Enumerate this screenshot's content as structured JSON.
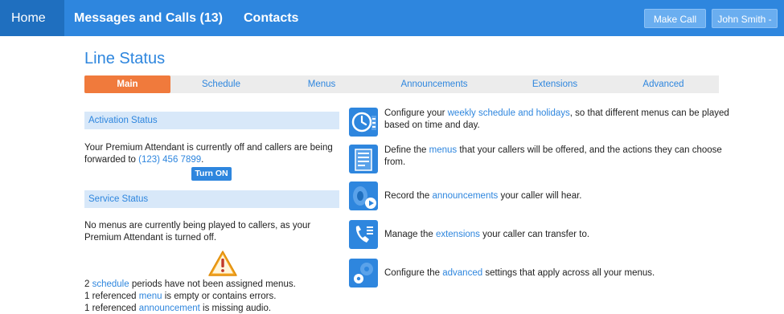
{
  "topbar": {
    "home": "Home",
    "messages": "Messages and Calls (13)",
    "contacts": "Contacts",
    "make_call": "Make Call",
    "user": "John Smith -"
  },
  "page": {
    "title": "Line Status"
  },
  "tabs": [
    {
      "label": "Main",
      "active": true
    },
    {
      "label": "Schedule"
    },
    {
      "label": "Menus"
    },
    {
      "label": "Announcements"
    },
    {
      "label": "Extensions"
    },
    {
      "label": "Advanced"
    }
  ],
  "activation": {
    "heading": "Activation Status",
    "text_1": "Your Premium Attendant is currently off and callers are being forwarded to ",
    "phone": "(123) 456 7899",
    "text_2": ".",
    "button": "Turn ON"
  },
  "service": {
    "heading": "Service Status",
    "text": "No menus are currently being played to callers, as your Premium Attendant is turned off.",
    "issue_1_pre": "2 ",
    "issue_1_link": "schedule",
    "issue_1_post": " periods have not been assigned menus.",
    "issue_2_pre": "1 referenced ",
    "issue_2_link": "menu",
    "issue_2_post": " is empty or contains errors.",
    "issue_3_pre": "1 referenced ",
    "issue_3_link": "announcement",
    "issue_3_post": " is missing audio."
  },
  "features": [
    {
      "icon": "clock-icon",
      "pre": "Configure your ",
      "link": "weekly schedule and holidays",
      "post": ", so that different menus can be played based on time and day."
    },
    {
      "icon": "menu-list-icon",
      "pre": "Define the ",
      "link": "menus",
      "post": " that your callers will be offered, and the actions they can choose from."
    },
    {
      "icon": "speaker-play-icon",
      "pre": "Record the ",
      "link": "announcements",
      "post": " your caller will hear."
    },
    {
      "icon": "phone-extensions-icon",
      "pre": "Manage the ",
      "link": "extensions",
      "post": " your caller can transfer to."
    },
    {
      "icon": "gears-icon",
      "pre": "Configure the ",
      "link": "advanced",
      "post": " settings that apply across all your menus."
    }
  ],
  "colors": {
    "primary": "#2e86de",
    "active_tab": "#f07a3c",
    "section_bg": "#d8e8f9",
    "warning": "#f5a623"
  }
}
